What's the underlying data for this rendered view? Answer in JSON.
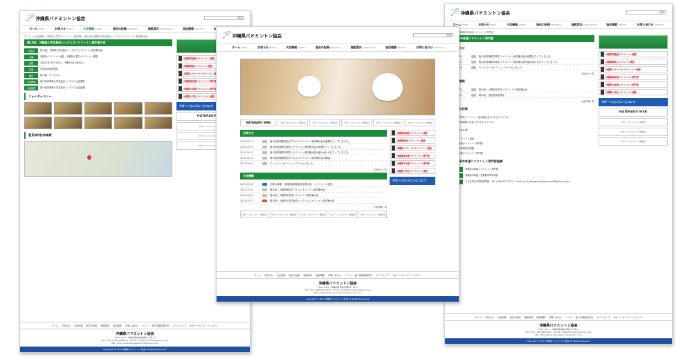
{
  "site": {
    "title": "沖縄県バドミントン協会",
    "search_button": "検索",
    "nav": [
      {
        "label": "ホーム",
        "sub": "HOME"
      },
      {
        "label": "お知らせ",
        "sub": "NEWS"
      },
      {
        "label": "大会情報",
        "sub": "GAMES"
      },
      {
        "label": "過去の記録",
        "sub": "RECORDS"
      },
      {
        "label": "施設案内",
        "sub": "GYMNASIUM"
      },
      {
        "label": "協会概要",
        "sub": "ABOUTS"
      },
      {
        "label": "お問い合わせ",
        "sub": "CONTACT"
      }
    ],
    "side_banners": [
      "沖縄県実業団バドミントン連盟",
      "沖縄県教員バドミントン連盟",
      "沖縄県レディースバドミントン連盟",
      "沖縄県高体連バドミントン専門部",
      "沖縄県中体連バドミントン専門部",
      "沖縄県小学生バドミントン連盟"
    ],
    "support_title": "サポートカンパニーについて",
    "hataraku": "HATARAKU WEB",
    "sponsor": "サポートカンパニー募集中",
    "footer_nav": [
      "ホーム",
      "お知らせ",
      "大会情報",
      "過去の記録",
      "施設案内",
      "協会概要",
      "お問い合わせ",
      "リンク",
      "個人情報保護方針",
      "サイトマップ",
      "サポートカンパニーについて"
    ],
    "footer_addr": "〒901-0301　沖縄県豊見城市豊崎1丁目1-1",
    "footer_tel": "TEL / FAX | 098-969-6320　E-mail | okibado.kenkai@yahoo.co.jp",
    "footer_url": "URL | http://www.okinawaken-badminton.com",
    "copyright": "Copyright © 2012 沖縄県バドミントン協会 All Rights Reserved."
  },
  "left": {
    "crumb": "ホーム > 大会情報 > 沖縄県小学生バドミントン選手権 > 第10回 沖縄県小学生総合シングルスバドミントン選手権大会",
    "heading": "第10回　沖縄県小学生総合シングルスバドミントン選手権大会",
    "details": [
      {
        "k": "大会名",
        "v": "第10回　沖縄県小学生総合シングルスバドミントン選手権大会"
      },
      {
        "k": "主催",
        "v": "沖縄県バドミントン協会　沖縄県小学生バドミントン連盟"
      },
      {
        "k": "日程",
        "v": "平成24年3月17日(土)　予備日3月18日(日)"
      },
      {
        "k": "会場",
        "v": "豊見城市民体育館"
      },
      {
        "k": "種目",
        "v": "個人戦　シングルス"
      },
      {
        "k": "大会要項",
        "v": "第10回沖縄県小学生総合シングルス大会要項"
      },
      {
        "k": "大会結果",
        "v": "第10回沖縄県小学生総合シングルス大会結果"
      }
    ],
    "photo_title": "フォトギャラリー",
    "map_title": "豊見城市民体育館"
  },
  "center": {
    "news_title": "お知らせ",
    "news": [
      {
        "date": "2012.04.24",
        "tag": "",
        "text": "第10回沖縄県総合ダブルスバドミントン選手権大会の結果をアップしました。"
      },
      {
        "date": "2012.04.24",
        "tag": "",
        "text": "第10回沖縄県中学生バドミントン選手権大会の結果をアップしました。"
      },
      {
        "date": "2012.04.23",
        "tag": "",
        "text": "第10回沖縄県中学生バドミントン選手権大会の組み合わせをアップしました。"
      },
      {
        "date": "2012.04.23",
        "tag": "",
        "text": "第10回沖縄県総合ダブルスバドミントン選手権大会の要項。"
      },
      {
        "date": "2012.04.04",
        "tag": "",
        "text": "ホームページをリニューアルいたしました。"
      }
    ],
    "news_more": "お知らせ一覧",
    "games_title": "大会情報",
    "games": [
      {
        "date": "2012.05.02",
        "tag": "b",
        "text": "平成24年度　沖縄県高体連総合体育大会　バドミントン競技"
      },
      {
        "date": "2012.05.01",
        "tag": "",
        "text": "第10回　沖縄県総合ダブルスバドミントン選手権大会"
      },
      {
        "date": "2012.04.07",
        "tag": "",
        "text": "第10回　沖縄県中学生バドミントン選手権大会"
      },
      {
        "date": "2012.03.21",
        "tag": "r",
        "text": "第10回　沖縄県小学生総合シングルスバドミントン選手権大会"
      }
    ],
    "games_more": "大会情報一覧"
  },
  "right": {
    "crumb": "ホーム > 沖縄県中体連バドミントン専門部",
    "heading": "沖縄県中体連バドミントン専門部",
    "news_title": "お知らせ",
    "news": [
      {
        "date": "2012.04.24",
        "text": "第10回沖縄県中学生バドミントン選手権大会の結果をアップしました。"
      },
      {
        "date": "2012.04.23",
        "text": "第10回沖縄県中学生バドミントン選手権大会の組み合わせをアップしました。"
      },
      {
        "date": "2012.04.04",
        "text": "ホームページをリニューアルいたしました。"
      }
    ],
    "news_more": "お知らせ一覧",
    "games_title": "大会情報",
    "games": [
      {
        "date": "2012.04.24",
        "text": "第10回　沖縄県中学生バドミントン選手権大会"
      },
      {
        "date": "2012.04.07",
        "text": "第10回　強化選手選考会"
      }
    ],
    "games_more": "大会情報一覧",
    "records_title": "過去の記録",
    "records": [
      "沖縄県中学生バドミントン選手権大会 (エクセルファイル)",
      "沖縄県中体連新人大会 (エクセルファイル)"
    ],
    "links_title": "関連リンク",
    "links": [
      "日本バドミントン協会",
      "日本中体連バドミントン専門部",
      "沖縄県中学校体育連盟",
      "九州中体連バドミントン専門部"
    ],
    "org_title": "沖縄県中体連バドミントン専門部組織",
    "org": [
      {
        "k": "名称",
        "v": "沖縄県中体連バドミントン専門部"
      },
      {
        "k": "所在",
        "v": "沖縄県中体連 / 豊見城市内中学校"
      },
      {
        "k": "連絡先",
        "v": "うるま市立中学校専門部　TEL | 098-972-5270　E-mail | chi_okiwajima_badominton@yahoo.co.jp"
      }
    ]
  }
}
